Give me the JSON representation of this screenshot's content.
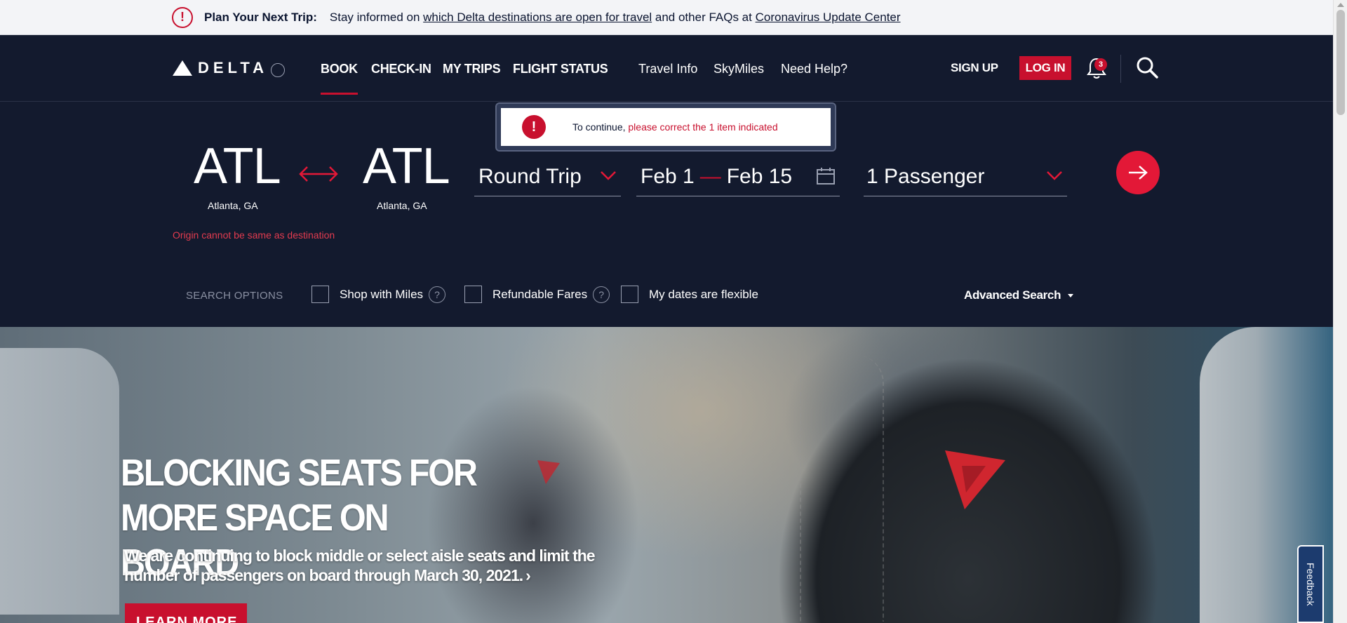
{
  "alert": {
    "title": "Plan Your Next Trip:",
    "text_before": "Stay informed on ",
    "link1": "which Delta destinations are open for travel",
    "text_middle": " and other FAQs at ",
    "link2": "Coronavirus Update Center"
  },
  "header": {
    "logo_text": "DELTA",
    "nav": [
      "BOOK",
      "CHECK-IN",
      "MY TRIPS",
      "FLIGHT STATUS"
    ],
    "secondary_nav": [
      "Travel Info",
      "SkyMiles",
      "Need Help?"
    ],
    "signup": "SIGN UP",
    "login": "LOG IN",
    "notification_count": "3"
  },
  "error_popup": {
    "prefix": "To continue, ",
    "highlight": "please correct the 1 item indicated",
    "icon": "!"
  },
  "booking": {
    "origin_code": "ATL",
    "origin_city": "Atlanta, GA",
    "destination_code": "ATL",
    "destination_city": "Atlanta, GA",
    "error": "Origin cannot be same as destination",
    "trip_type": "Round Trip",
    "depart_date": "Feb 1",
    "return_date": "Feb 15",
    "passengers": "1 Passenger"
  },
  "search_options": {
    "label": "SEARCH OPTIONS",
    "shop_with_miles": "Shop with Miles",
    "refundable_fares": "Refundable Fares",
    "flexible_dates": "My dates are flexible",
    "advanced_search": "Advanced Search",
    "help_glyph": "?"
  },
  "hero": {
    "title_line1": "BLOCKING SEATS FOR",
    "title_line2": "MORE SPACE ON BOARD",
    "subtitle_line1": "We are continuing to block middle or select aisle seats and limit the",
    "subtitle_line2": "number of passengers on board through March 30, 2021.",
    "subtitle_arrow": "›",
    "cta": "LEARN MORE"
  },
  "feedback_label": "Feedback",
  "colors": {
    "navy": "#131a2e",
    "red": "#c8102e",
    "error_text": "#e23b4f"
  }
}
